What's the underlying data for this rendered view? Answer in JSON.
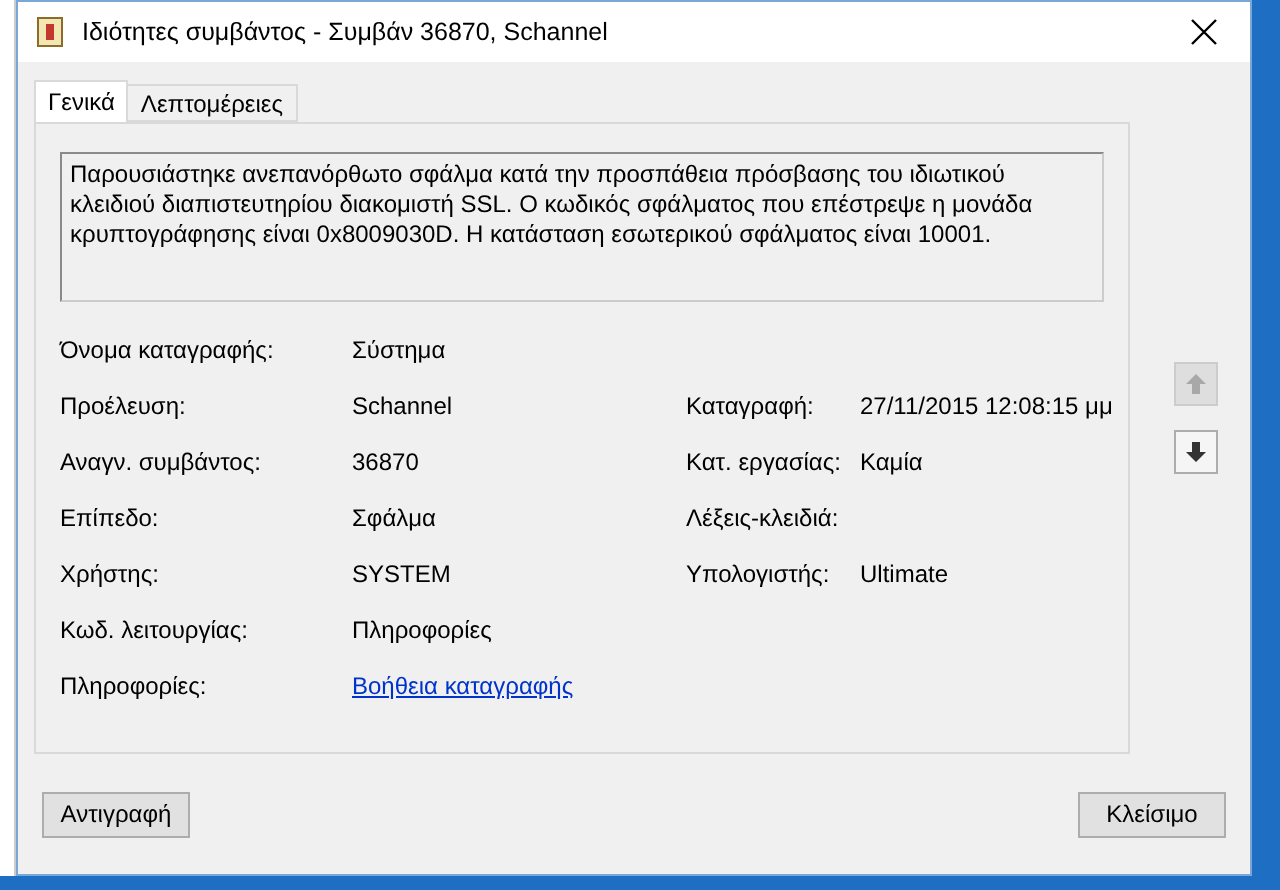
{
  "window": {
    "title": "Ιδιότητες συμβάντος - Συμβάν 36870, Schannel"
  },
  "tabs": [
    {
      "label": "Γενικά",
      "selected": true
    },
    {
      "label": "Λεπτομέρειες",
      "selected": false
    }
  ],
  "description": "Παρουσιάστηκε ανεπανόρθωτο σφάλμα κατά την προσπάθεια πρόσβασης του ιδιωτικού κλειδιού διαπιστευτηρίου διακομιστή SSL. Ο κωδικός σφάλματος που επέστρεψε η μονάδα κρυπτογράφησης είναι 0x8009030D. Η κατάσταση εσωτερικού σφάλματος είναι 10001.",
  "rows": [
    {
      "label": "Όνομα καταγραφής:",
      "value": "Σύστημα"
    },
    {
      "label": "Προέλευση:",
      "value": "Schannel",
      "right_label": "Καταγραφή:",
      "right_value": "27/11/2015 12:08:15 μμ"
    },
    {
      "label": "Αναγν. συμβάντος:",
      "value": "36870",
      "right_label": "Κατ. εργασίας:",
      "right_value": "Καμία"
    },
    {
      "label": "Επίπεδο:",
      "value": "Σφάλμα",
      "right_label": "Λέξεις-κλειδιά:"
    },
    {
      "label": "Χρήστης:",
      "value": "SYSTEM",
      "right_label": "Υπολογιστής:",
      "right_value": "Ultimate"
    },
    {
      "label": "Κωδ. λειτουργίας:",
      "value": "Πληροφορίες"
    },
    {
      "label": "Πληροφορίες:",
      "value": "Βοήθεια καταγραφής",
      "kind": "link"
    }
  ],
  "nav": {
    "up_disabled": true,
    "down_disabled": false
  },
  "buttons": [
    "Αντιγραφή",
    "Κλείσιμο"
  ]
}
